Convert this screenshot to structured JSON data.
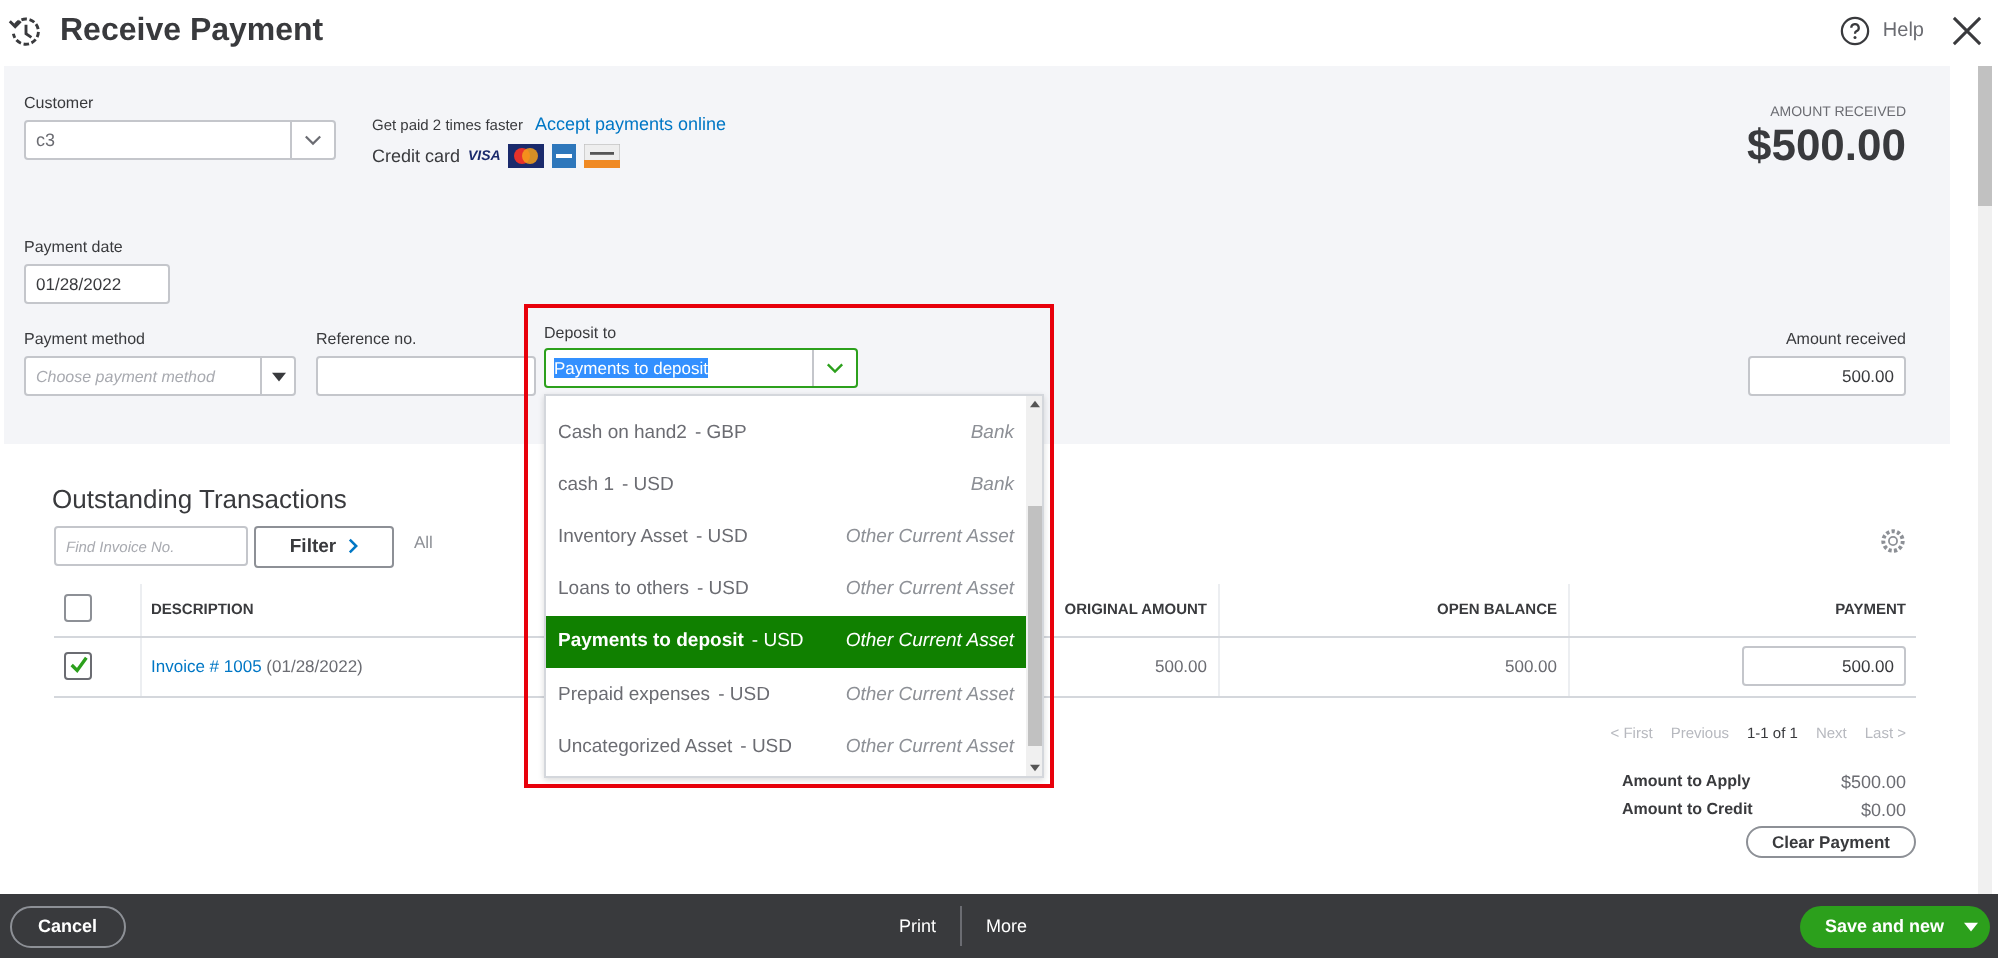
{
  "header": {
    "title": "Receive Payment",
    "help": "Help"
  },
  "customer": {
    "label": "Customer",
    "value": "c3"
  },
  "promo": {
    "text": "Get paid 2 times faster",
    "link": "Accept payments online",
    "card_label": "Credit card",
    "visa": "VISA"
  },
  "amount_summary": {
    "label": "AMOUNT RECEIVED",
    "value": "$500.00"
  },
  "payment_date": {
    "label": "Payment date",
    "value": "01/28/2022"
  },
  "payment_method": {
    "label": "Payment method",
    "placeholder": "Choose payment method"
  },
  "reference": {
    "label": "Reference no."
  },
  "deposit_to": {
    "label": "Deposit to",
    "value": "Payments to deposit",
    "options": [
      {
        "name": "Cash on hand2",
        "currency": "- GBP",
        "type": "Bank",
        "selected": false
      },
      {
        "name": "cash 1",
        "currency": "- USD",
        "type": "Bank",
        "selected": false
      },
      {
        "name": "Inventory Asset",
        "currency": "- USD",
        "type": "Other Current Asset",
        "selected": false
      },
      {
        "name": "Loans to others",
        "currency": "- USD",
        "type": "Other Current Asset",
        "selected": false
      },
      {
        "name": "Payments to deposit",
        "currency": "- USD",
        "type": "Other Current Asset",
        "selected": true
      },
      {
        "name": "Prepaid expenses",
        "currency": "- USD",
        "type": "Other Current Asset",
        "selected": false
      },
      {
        "name": "Uncategorized Asset",
        "currency": "- USD",
        "type": "Other Current Asset",
        "selected": false
      }
    ]
  },
  "amount_received": {
    "label": "Amount received",
    "value": "500.00"
  },
  "outstanding": {
    "title": "Outstanding Transactions",
    "search_placeholder": "Find Invoice No.",
    "filter": "Filter",
    "filter_value": "All",
    "header_checked": false,
    "columns": [
      "DESCRIPTION",
      "ORIGINAL AMOUNT",
      "OPEN BALANCE",
      "PAYMENT"
    ],
    "rows": [
      {
        "checked": true,
        "invoice": "Invoice # 1005",
        "date": "(01/28/2022)",
        "original_amount": "500.00",
        "open_balance": "500.00",
        "payment": "500.00"
      }
    ],
    "pagination": [
      {
        "label": "< First",
        "disabled": true
      },
      {
        "label": "Previous",
        "disabled": true
      },
      {
        "label": "1-1 of 1",
        "disabled": false
      },
      {
        "label": "Next",
        "disabled": true
      },
      {
        "label": "Last >",
        "disabled": true
      }
    ]
  },
  "totals": [
    {
      "label": "Amount to Apply",
      "value": "$500.00"
    },
    {
      "label": "Amount to Credit",
      "value": "$0.00"
    }
  ],
  "clear_button": "Clear Payment",
  "footer": {
    "cancel": "Cancel",
    "print": "Print",
    "more": "More",
    "save": "Save and new"
  }
}
